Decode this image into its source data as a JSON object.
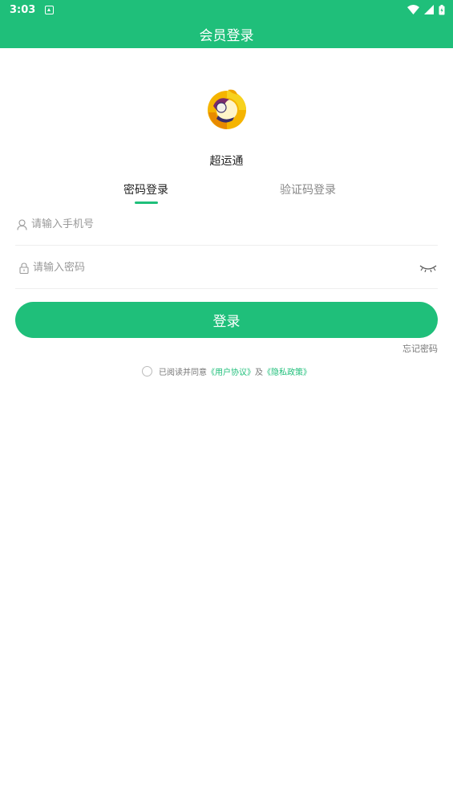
{
  "status_bar": {
    "time": "3:03"
  },
  "app_bar": {
    "title": "会员登录"
  },
  "app": {
    "name": "超运通"
  },
  "tabs": [
    {
      "label": "密码登录",
      "active": true
    },
    {
      "label": "验证码登录",
      "active": false
    }
  ],
  "form": {
    "phone_placeholder": "请输入手机号",
    "phone_value": "",
    "password_placeholder": "请输入密码",
    "password_value": ""
  },
  "login_button": {
    "label": "登录"
  },
  "forgot_password": {
    "label": "忘记密码"
  },
  "agreement": {
    "prefix": "已阅读并同意",
    "user_agreement": "《用户协议》",
    "joiner": "及",
    "privacy_policy": "《隐私政策》",
    "checked": false
  },
  "colors": {
    "accent": "#1fbf7a",
    "muted_text": "#999999",
    "divider": "#eeeeee"
  }
}
